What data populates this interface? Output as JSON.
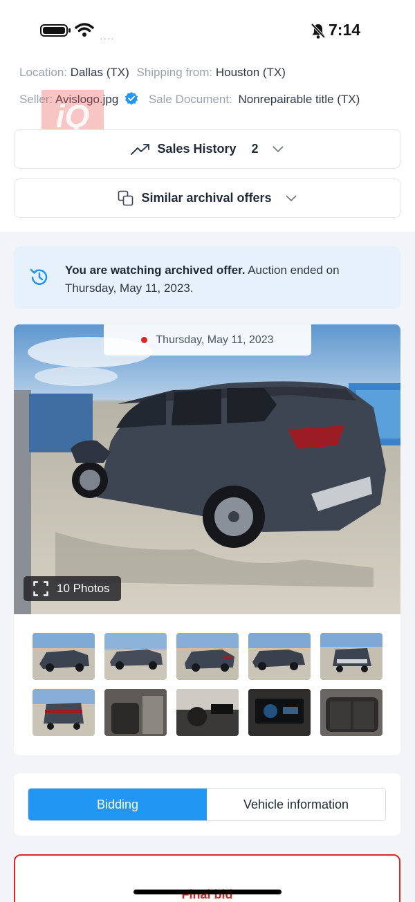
{
  "status_bar": {
    "time": "7:14",
    "icons": [
      "battery-icon",
      "wifi-icon",
      "signal-dots",
      "bell-off-icon"
    ],
    "signal": "...."
  },
  "watermark": {
    "text": "iQ"
  },
  "details": {
    "location_label": "Location:",
    "location_value": "Dallas (TX)",
    "shipping_label": "Shipping from:",
    "shipping_value": "Houston (TX)",
    "seller_label": "Seller:",
    "seller_value": "Avislogo.jpg",
    "sale_doc_label": "Sale Document:",
    "sale_doc_value": "Nonrepairable title (TX)"
  },
  "sales_history": {
    "label": "Sales History",
    "count": "2",
    "icon": "trend-icon"
  },
  "similar_offers": {
    "label": "Similar archival offers",
    "icon": "copy-icon"
  },
  "archive_notice": {
    "bold": "You are watching archived offer.",
    "rest": " Auction ended on Thursday, May 11, 2023.",
    "icon": "history-icon"
  },
  "gallery": {
    "date": "Thursday, May 11, 2023",
    "photos_label": "10 Photos",
    "thumbnails": [
      "front-left",
      "left-side",
      "rear-left",
      "front-right",
      "front",
      "rear",
      "interior-driver",
      "dashboard",
      "instrument-cluster",
      "rear-seats"
    ]
  },
  "tabs": {
    "bidding": "Bidding",
    "vehicle_info": "Vehicle information"
  },
  "final_bid": {
    "label": "Final bid"
  },
  "colors": {
    "accent": "#2196f3",
    "danger": "#dc2626",
    "banner": "#e7f1fb"
  }
}
